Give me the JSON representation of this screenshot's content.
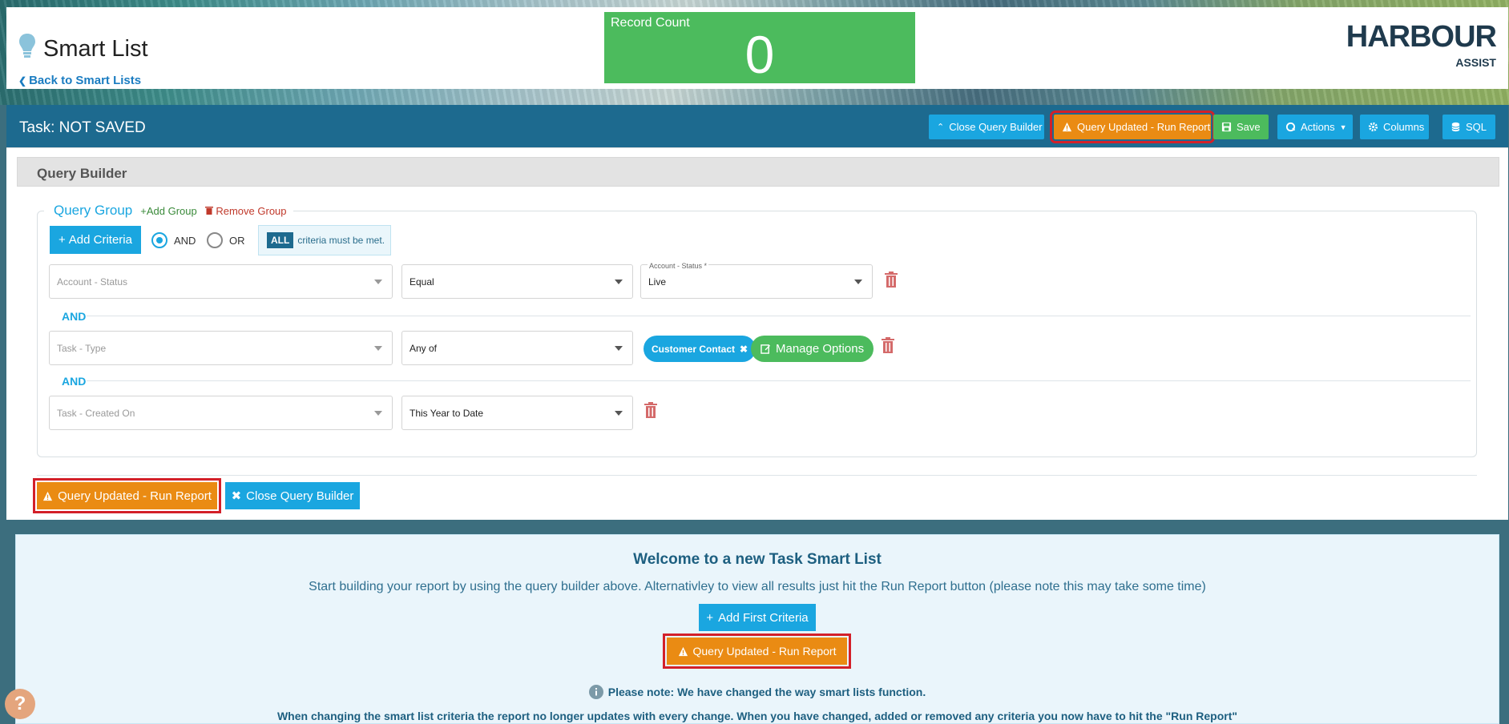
{
  "header": {
    "title": "Smart List",
    "back_link": "Back to Smart Lists",
    "record_count_label": "Record Count",
    "record_count_value": "0",
    "logo_main": "HARBOUR",
    "logo_sub": "ASSIST"
  },
  "toolbar": {
    "task_title": "Task: NOT SAVED",
    "close_query_builder": "Close Query Builder",
    "run_report": "Query Updated - Run Report",
    "save": "Save",
    "actions": "Actions",
    "columns": "Columns",
    "sql": "SQL"
  },
  "query_builder": {
    "title": "Query Builder",
    "group": {
      "title": "Query Group",
      "add_group": "Add Group",
      "remove_group": "Remove Group",
      "add_criteria": "Add Criteria",
      "logic_and": "AND",
      "logic_or": "OR",
      "selected_logic": "AND",
      "all_badge": "ALL",
      "all_note": "criteria must be met."
    },
    "criteria": [
      {
        "field_placeholder": "Account - Status",
        "operator": "Equal",
        "value_label": "Account - Status *",
        "value": "Live"
      },
      {
        "field_placeholder": "Task - Type",
        "operator": "Any of",
        "chips": [
          "Customer Contact"
        ],
        "manage_options": "Manage Options"
      },
      {
        "field_placeholder": "Task - Created On",
        "operator": "This Year to Date"
      }
    ],
    "connector": "AND",
    "run_report": "Query Updated - Run Report",
    "close": "Close Query Builder"
  },
  "welcome": {
    "title": "Welcome to a new Task Smart List",
    "text": "Start building your report by using the query builder above. Alternativley to view all results just hit the Run Report button (please note this may take some time)",
    "add_first": "Add First Criteria",
    "run_report": "Query Updated - Run Report",
    "note_title": "Please note: We have changed the way smart lists function.",
    "note_text": "When changing the smart list criteria the report no longer updates with every change. When you have changed, added or removed any criteria you now have to hit the \"Run Report\""
  },
  "help": {
    "label": "?"
  },
  "colors": {
    "primary_blue": "#1aa6e0",
    "toolbar_blue": "#1d6a8f",
    "success_green": "#4cbb5d",
    "warning_orange": "#ea8b13",
    "highlight_red": "#d32029"
  }
}
